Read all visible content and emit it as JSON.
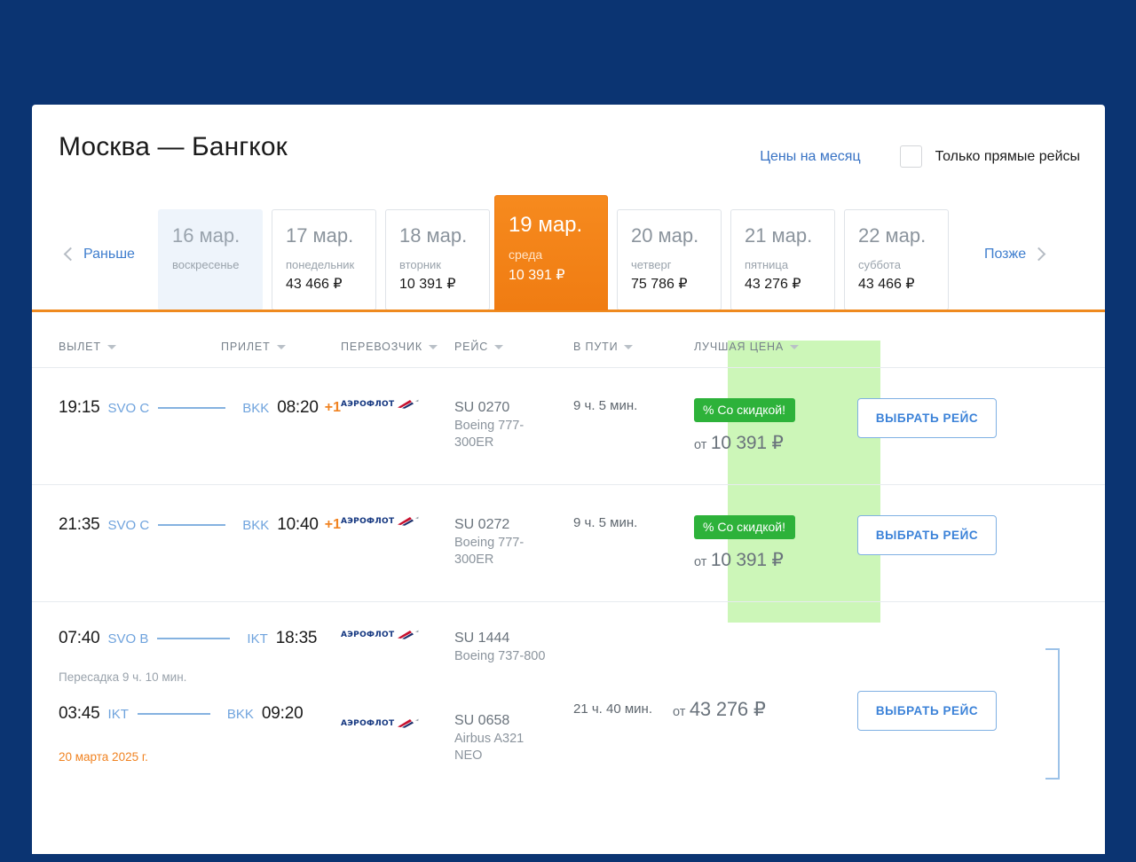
{
  "header": {
    "title": "Москва — Бангкок",
    "month_prices_link": "Цены на месяц",
    "direct_only_label": "Только прямые рейсы",
    "direct_only_checked": false
  },
  "date_strip": {
    "earlier_label": "Раньше",
    "later_label": "Позже",
    "days": [
      {
        "date": "16 мар.",
        "weekday": "воскресенье",
        "price": "",
        "state": "disabled"
      },
      {
        "date": "17 мар.",
        "weekday": "понедельник",
        "price": "43 466 ₽",
        "state": "normal"
      },
      {
        "date": "18 мар.",
        "weekday": "вторник",
        "price": "10 391 ₽",
        "state": "normal"
      },
      {
        "date": "19 мар.",
        "weekday": "среда",
        "price": "10 391 ₽",
        "state": "active"
      },
      {
        "date": "20 мар.",
        "weekday": "четверг",
        "price": "75 786 ₽",
        "state": "normal"
      },
      {
        "date": "21 мар.",
        "weekday": "пятница",
        "price": "43 276 ₽",
        "state": "normal"
      },
      {
        "date": "22 мар.",
        "weekday": "суббота",
        "price": "43 466 ₽",
        "state": "normal"
      }
    ]
  },
  "table": {
    "columns": {
      "departure": "ВЫЛЕТ",
      "arrival": "ПРИЛЕТ",
      "carrier": "ПЕРЕВОЗЧИК",
      "flight": "РЕЙС",
      "duration": "В ПУТИ",
      "best_price": "ЛУЧШАЯ ЦЕНА"
    }
  },
  "flights": [
    {
      "legs": [
        {
          "depart_time": "19:15",
          "depart_iata": "SVO C",
          "arrive_iata": "BKK",
          "arrive_time": "08:20",
          "next_day": "+1",
          "carrier": "Аэрофлот",
          "flight_no": "SU 0270",
          "aircraft": "Boeing 777-300ER"
        }
      ],
      "duration": "9 ч. 5 мин.",
      "discount_badge": "% Со скидкой!",
      "price_from": "от",
      "price_value": "10 391 ₽",
      "select_label": "ВЫБРАТЬ РЕЙС"
    },
    {
      "legs": [
        {
          "depart_time": "21:35",
          "depart_iata": "SVO C",
          "arrive_iata": "BKK",
          "arrive_time": "10:40",
          "next_day": "+1",
          "carrier": "Аэрофлот",
          "flight_no": "SU 0272",
          "aircraft": "Boeing 777-300ER"
        }
      ],
      "duration": "9 ч. 5 мин.",
      "discount_badge": "% Со скидкой!",
      "price_from": "от",
      "price_value": "10 391 ₽",
      "select_label": "ВЫБРАТЬ РЕЙС"
    },
    {
      "legs": [
        {
          "depart_time": "07:40",
          "depart_iata": "SVO B",
          "arrive_iata": "IKT",
          "arrive_time": "18:35",
          "next_day": "",
          "carrier": "Аэрофлот",
          "flight_no": "SU 1444",
          "aircraft": "Boeing 737-800"
        },
        {
          "depart_time": "03:45",
          "depart_iata": "IKT",
          "arrive_iata": "BKK",
          "arrive_time": "09:20",
          "next_day": "",
          "carrier": "Аэрофлот",
          "flight_no": "SU 0658",
          "aircraft": "Airbus A321 NEO"
        }
      ],
      "transfer_note": "Пересадка 9 ч. 10 мин.",
      "arrival_date_note": "20 марта 2025 г.",
      "duration": "21 ч. 40 мин.",
      "discount_badge": "",
      "price_from": "от",
      "price_value": "43 276 ₽",
      "select_label": "ВЫБРАТЬ РЕЙС"
    }
  ],
  "colors": {
    "background": "#0b3472",
    "accent_orange": "#ef8a1f",
    "link_blue": "#3772c4",
    "best_price_bg": "#ccf6b8",
    "discount_green": "#2db23a",
    "carrier_navy": "#12357f",
    "carrier_red": "#c8102e"
  }
}
